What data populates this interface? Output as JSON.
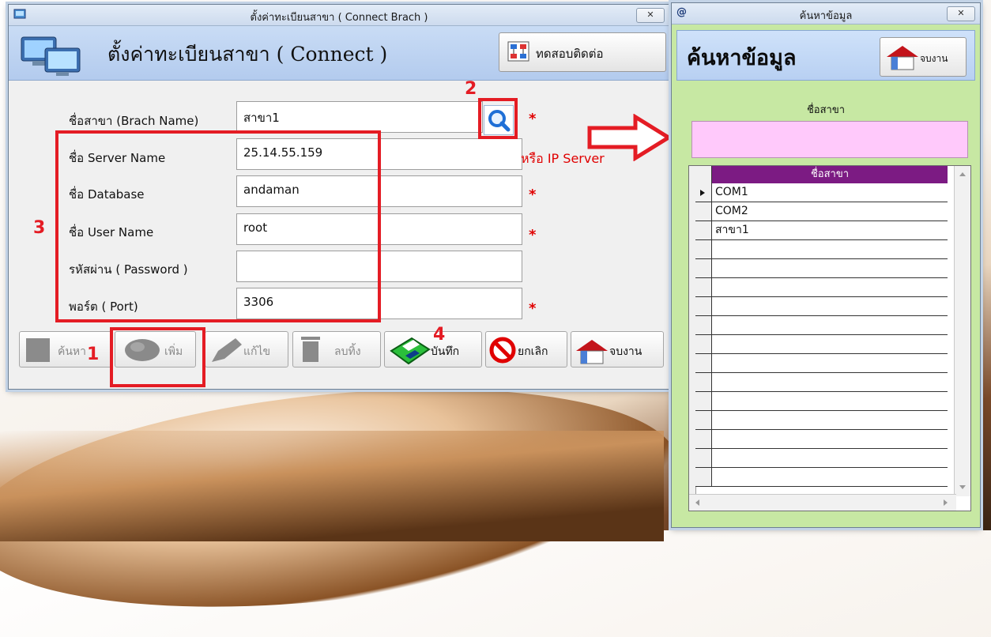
{
  "left_window": {
    "title": "ตั้งค่าทะเบียนสาขา ( Connect Brach )",
    "close_glyph": "✕",
    "header_title": "ตั้งค่าทะเบียนสาขา ( Connect )",
    "test_button_label": "ทดสอบติดต่อ",
    "fields": {
      "branch_label": "ชื่อสาขา (Brach Name)",
      "branch_value": "สาขา1",
      "server_label": "ชื่อ  Server Name",
      "server_value": "25.14.55.159",
      "server_note": "หรือ IP Server",
      "database_label": "ชื่อ Database",
      "database_value": "andaman",
      "user_label": "ชื่อ User Name",
      "user_value": "root",
      "password_label": "รหัสผ่าน ( Password )",
      "password_value": "",
      "port_label": "พอร์ต ( Port)",
      "port_value": "3306",
      "required_mark": "*"
    },
    "toolbar": {
      "search": "ค้นหา",
      "add": "เพิ่ม",
      "edit": "แก้ไข",
      "delete": "ลบทิ้ง",
      "save": "บันทึก",
      "cancel": "ยกเลิก",
      "close": "จบงาน"
    },
    "annotations": {
      "n1": "1",
      "n2": "2",
      "n3": "3",
      "n4": "4"
    }
  },
  "right_window": {
    "app_glyph": "@",
    "title": "ค้นหาข้อมูล",
    "close_glyph": "✕",
    "header_title": "ค้นหาข้อมูล",
    "close_button_label": "จบงาน",
    "search_label": "ชื่อสาขา",
    "search_value": "",
    "grid": {
      "column_header": "ชื่อสาขา",
      "rows": [
        "COM1",
        "COM2",
        "สาขา1"
      ]
    }
  },
  "colors": {
    "annotation_red": "#e41c24",
    "grid_header": "#7c1b83",
    "search_box": "#ffc9fb",
    "panel_green": "#c7e8a3"
  }
}
